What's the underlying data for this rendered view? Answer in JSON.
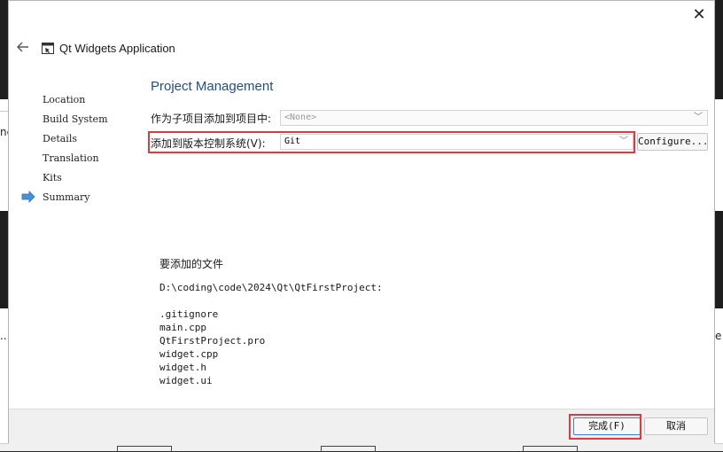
{
  "window": {
    "title": "Qt Widgets Application",
    "close_icon": "close-icon",
    "back_icon": "back-arrow-icon"
  },
  "steps": {
    "items": [
      {
        "label": "Location"
      },
      {
        "label": "Build System"
      },
      {
        "label": "Details"
      },
      {
        "label": "Translation"
      },
      {
        "label": "Kits"
      },
      {
        "label": "Summary",
        "current": true
      }
    ],
    "current_indicator_icon": "current-step-arrow-icon"
  },
  "page": {
    "title": "Project Management",
    "add_as_subproject_label": "作为子项目添加到项目中:",
    "add_as_subproject_value": "<None>",
    "vcs_label": "添加到版本控制系统(V):",
    "vcs_value": "Git",
    "configure_label": "Configure..."
  },
  "files": {
    "heading": "要添加的文件",
    "path": "D:\\coding\\code\\2024\\Qt\\QtFirstProject:",
    "list": [
      ".gitignore",
      "main.cpp",
      "QtFirstProject.pro",
      "widget.cpp",
      "widget.h",
      "widget.ui"
    ]
  },
  "footer": {
    "finish_label": "完成(F)",
    "cancel_label": "取消"
  },
  "background": {
    "left_fragments": [
      "nc",
      "..."
    ],
    "right_fragments": [
      "e"
    ]
  },
  "colors": {
    "title_blue": "#1f4e8c",
    "highlight_red": "#e0393e",
    "step_arrow_blue": "#4a90d9"
  }
}
